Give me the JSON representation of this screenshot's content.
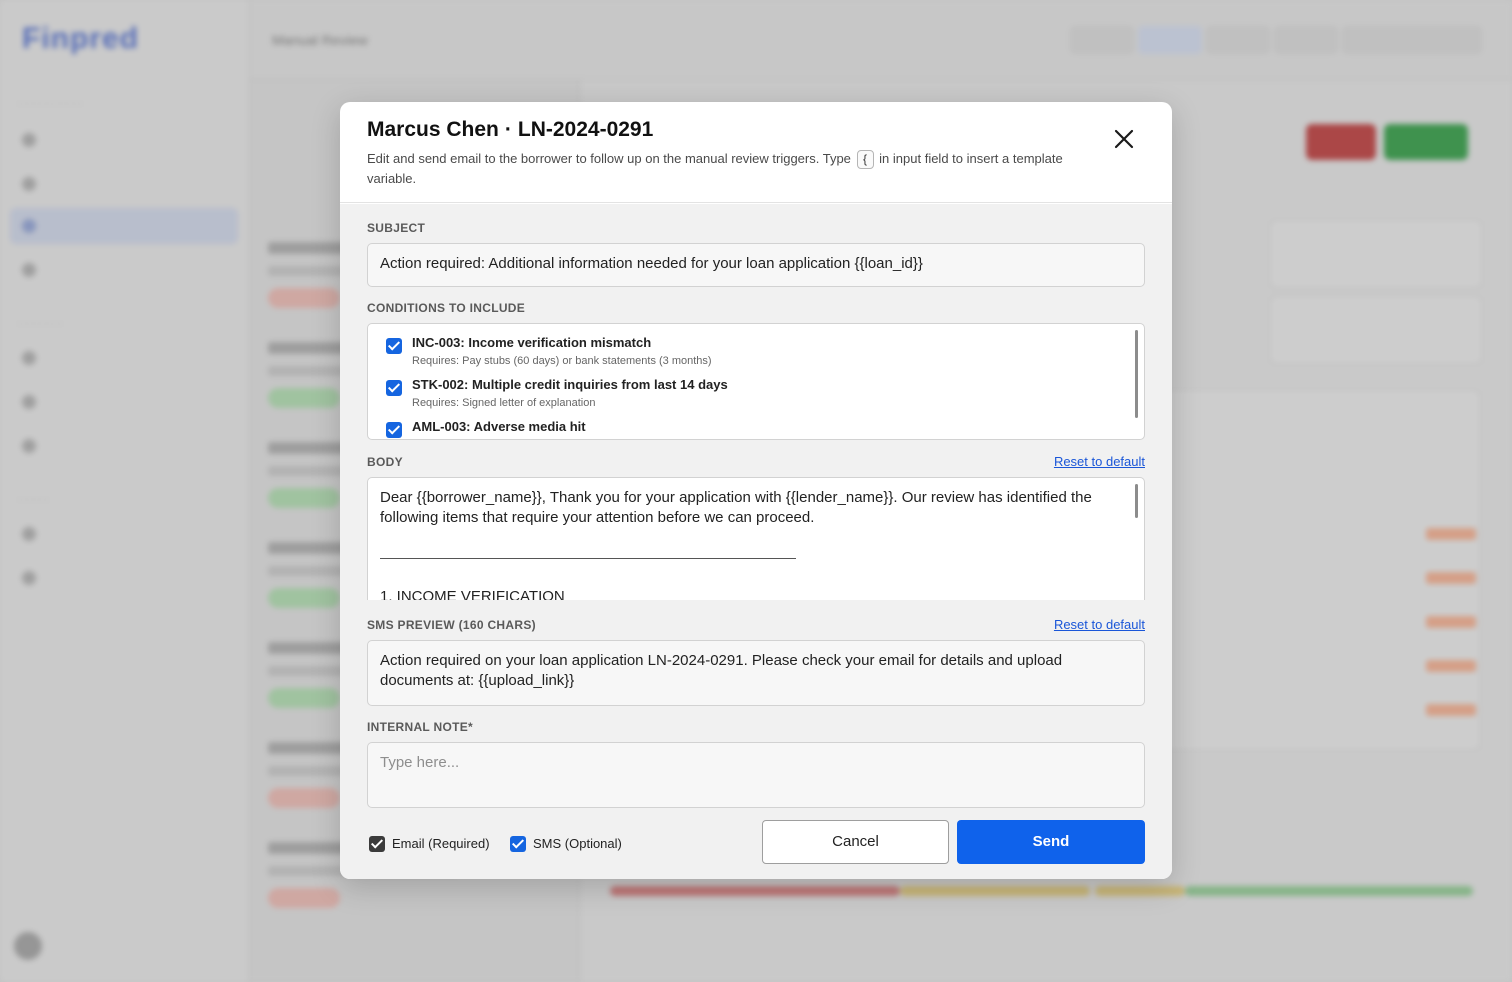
{
  "background": {
    "logo": "Finpred",
    "topbar_title": "Manual Review"
  },
  "modal": {
    "borrower_name": "Marcus Chen",
    "separator": "·",
    "loan_id": "LN-2024-0291",
    "description_before": "Edit and send email to the borrower to follow up on the manual review triggers. Type",
    "description_key": "{",
    "description_after": "in input field to insert a template variable.",
    "subject": {
      "label": "SUBJECT",
      "value": "Action required: Additional information needed for your loan application {{loan_id}}"
    },
    "conditions": {
      "label": "CONDITIONS TO INCLUDE",
      "items": [
        {
          "title": "INC-003: Income verification mismatch",
          "requirement": "Requires: Pay stubs (60 days) or bank statements (3 months)",
          "checked": true
        },
        {
          "title": "STK-002: Multiple credit inquiries from last 14 days",
          "requirement": "Requires: Signed letter of explanation",
          "checked": true
        },
        {
          "title": "AML-003: Adverse media hit",
          "requirement": "",
          "checked": true
        }
      ]
    },
    "body": {
      "label": "BODY",
      "reset_label": "Reset to default",
      "paragraph": "Dear {{borrower_name}}, Thank you for your application with {{lender_name}}. Our review has identified the following items that require your attention before we can proceed.",
      "section_heading": "1. INCOME VERIFICATION"
    },
    "sms": {
      "label": "SMS PREVIEW (160 CHARS)",
      "reset_label": "Reset to default",
      "value": "Action required on your loan application LN-2024-0291. Please check your email for details and upload documents at: {{upload_link}}"
    },
    "internal_note": {
      "label": "INTERNAL NOTE*",
      "placeholder": "Type here..."
    },
    "channels": {
      "email_label": "Email (Required)",
      "email_checked": true,
      "sms_label": "SMS (Optional)",
      "sms_checked": true
    },
    "buttons": {
      "cancel": "Cancel",
      "send": "Send"
    }
  },
  "colors": {
    "primary": "#0f62eb",
    "checkbox_blue": "#1565e0",
    "link": "#1a56d8"
  }
}
